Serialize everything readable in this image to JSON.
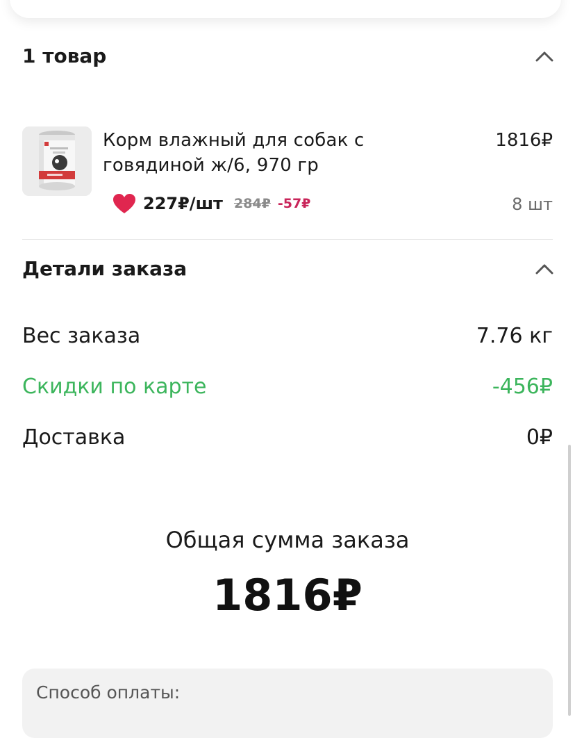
{
  "items_section": {
    "title": "1 товар"
  },
  "product": {
    "name": "Корм влажный для собак с говядиной ж/6, 970 гр",
    "total": "1816₽",
    "unit_price": "227₽/шт",
    "old_price": "284₽",
    "discount": "-57₽",
    "quantity": "8 шт"
  },
  "details_section": {
    "title": "Детали заказа",
    "rows": [
      {
        "label": "Вес заказа",
        "value": "7.76 кг"
      },
      {
        "label": "Скидки по карте",
        "value": "-456₽"
      },
      {
        "label": "Доставка",
        "value": "0₽"
      }
    ]
  },
  "summary": {
    "label": "Общая сумма заказа",
    "value": "1816₽"
  },
  "payment": {
    "label": "Способ оплаты:"
  },
  "colors": {
    "discount_red": "#c9255a",
    "card_discount_green": "#3cb55c",
    "heart": "#e0264f"
  },
  "icons": {
    "collapse": "chevron-up-icon",
    "favorite": "heart-icon"
  }
}
